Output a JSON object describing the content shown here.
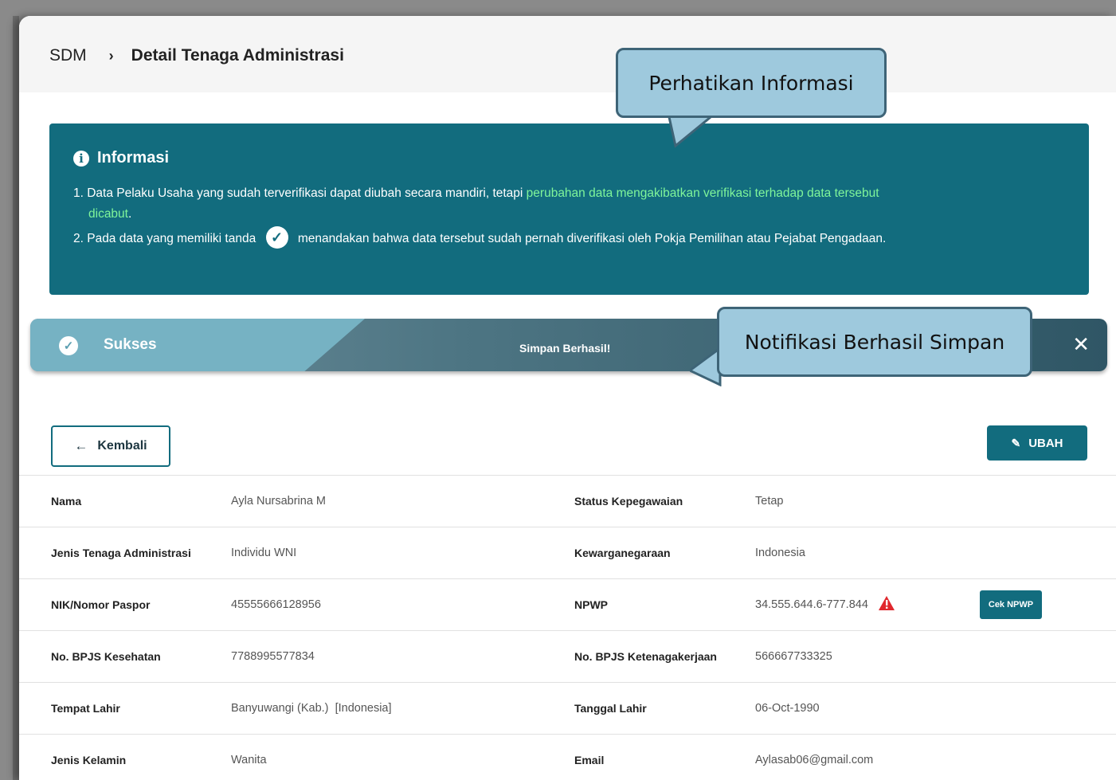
{
  "breadcrumb": {
    "root": "SDM",
    "separator": "›",
    "current": "Detail Tenaga Administrasi"
  },
  "info": {
    "title": "Informasi",
    "line1_prefix": "1. Data Pelaku Usaha yang sudah terverifikasi dapat diubah secara mandiri, tetapi ",
    "line1_highlight_a": "perubahan data mengakibatkan verifikasi terhadap data tersebut",
    "line1_highlight_b": "dicabut",
    "line1_suffix": ".",
    "line2_prefix": "2. Pada data yang memiliki tanda",
    "line2_suffix": "menandakan bahwa data tersebut sudah pernah diverifikasi oleh Pokja Pemilihan atau Pejabat Pengadaan."
  },
  "notification": {
    "title": "Sukses",
    "message": "Simpan Berhasil!",
    "close": "✕"
  },
  "callouts": {
    "info": "Perhatikan Informasi",
    "notif": "Notifikasi Berhasil Simpan"
  },
  "actions": {
    "back": "Kembali",
    "edit": "UBAH",
    "check_npwp": "Cek NPWP"
  },
  "details": {
    "nama_label": "Nama",
    "nama": "Ayla Nursabrina M",
    "status_label": "Status Kepegawaian",
    "status": "Tetap",
    "jenis_label": "Jenis Tenaga Administrasi",
    "jenis": "Individu WNI",
    "kewarganegaraan_label": "Kewarganegaraan",
    "kewarganegaraan": "Indonesia",
    "nik_label": "NIK/Nomor Paspor",
    "nik": "45555666128956",
    "npwp_label": "NPWP",
    "npwp": "34.555.644.6-777.844",
    "bpjs_kes_label": "No. BPJS Kesehatan",
    "bpjs_kes": "7788995577834",
    "bpjs_tk_label": "No. BPJS Ketenagakerjaan",
    "bpjs_tk": "566667733325",
    "tempat_lahir_label": "Tempat Lahir",
    "tempat_lahir": "Banyuwangi (Kab.)  [Indonesia]",
    "tanggal_lahir_label": "Tanggal Lahir",
    "tanggal_lahir": "06-Oct-1990",
    "kelamin_label": "Jenis Kelamin",
    "kelamin": "Wanita",
    "email_label": "Email",
    "email": "Aylasab06@gmail.com"
  },
  "colors": {
    "primary": "#126c7e",
    "highlight": "#7ff59a",
    "warning": "#e0282e",
    "callout": "#9ec9dd"
  },
  "icons": {
    "info": "info-circle-icon",
    "verified": "check-circle-icon",
    "success": "check-circle-icon",
    "back": "arrow-left-icon",
    "edit": "edit-icon",
    "warning": "warning-triangle-icon",
    "close": "close-icon"
  }
}
